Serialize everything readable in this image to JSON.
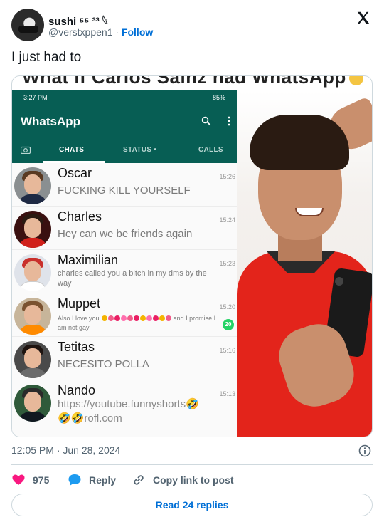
{
  "tweet": {
    "user_name": "sushi ⁵⁵ ³³ 𓆩",
    "user_handle": "@verstxppen1",
    "separator": "·",
    "follow_label": "Follow",
    "text": "I just had to",
    "timestamp": "12:05 PM · Jun 28, 2024",
    "likes_count": "975",
    "reply_label": "Reply",
    "copy_link_label": "Copy link to post",
    "read_replies_label": "Read 24 replies"
  },
  "media": {
    "meme_caption": "What if Carlos Sainz had WhatsApp",
    "whatsapp": {
      "status_time": "3:27 PM",
      "battery": "85%",
      "app_title": "WhatsApp",
      "tabs": [
        "CHATS",
        "STATUS •",
        "CALLS"
      ],
      "chats": [
        {
          "name": "Oscar",
          "time": "15:26",
          "message": "FUCKING KILL YOURSELF"
        },
        {
          "name": "Charles",
          "time": "15:24",
          "message": "Hey can we be friends again"
        },
        {
          "name": "Maximilian",
          "time": "15:23",
          "message": "charles called you a bitch in my dms by the way"
        },
        {
          "name": "Muppet",
          "time": "15:20",
          "message_start": "Also I love you",
          "message_end": "and I promise I am not gay",
          "unread": "20"
        },
        {
          "name": "Tetitas",
          "time": "15:16",
          "message": "NECESITO POLLA"
        },
        {
          "name": "Nando",
          "time": "15:13",
          "message_line1": "https://youtube.funnyshorts🤣",
          "message_line2": "🤣🤣rofl.com"
        }
      ]
    }
  },
  "colors": {
    "whatsapp_green": "#075e54",
    "unread_green": "#25d366",
    "link_blue": "#006fd6",
    "like_pink": "#f91880",
    "reply_blue": "#1d9bf0"
  },
  "icons": [
    "x-logo-icon",
    "search-icon",
    "more-icon",
    "camera-icon",
    "info-icon",
    "heart-icon",
    "speech-bubble-icon",
    "link-icon"
  ]
}
